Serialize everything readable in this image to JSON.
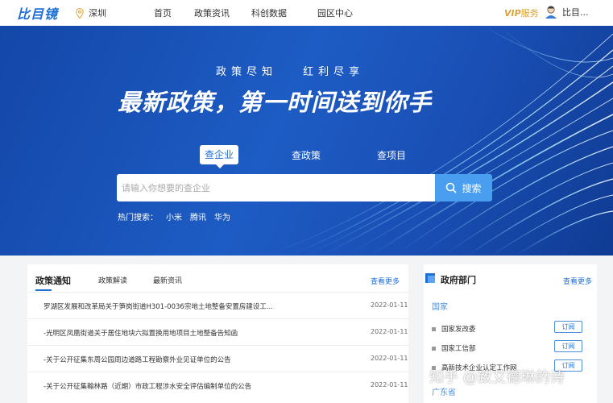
{
  "header": {
    "logo": "比目镜",
    "location": "深圳",
    "nav": [
      "首页",
      "政策资讯",
      "科创数据",
      "园区中心"
    ],
    "vip_label": "VIP",
    "vip_suffix": "服务",
    "user_name": "比目..."
  },
  "hero": {
    "slogan_left": "政策尽知",
    "slogan_right": "红利尽享",
    "headline": "最新政策，第一时间送到你手",
    "tabs": [
      "查企业",
      "查政策",
      "查项目"
    ],
    "active_tab": 0,
    "search_placeholder": "请输入你想要的查企业",
    "search_button": "搜索",
    "hot_label": "热门搜索：",
    "hot_keywords": [
      "小米",
      "腾讯",
      "华为"
    ]
  },
  "policy_panel": {
    "tabs": [
      "政策通知",
      "政策解读",
      "最新资讯"
    ],
    "active_tab": 0,
    "more": "查看更多",
    "items": [
      {
        "title": "罗湖区发展和改革局关于笋岗街道H301-0036宗地土地整备安置房建设工...",
        "date": "2022-01-11"
      },
      {
        "title": "-光明区凤凰街道关于居住地块六拟置换用地项目土地整备告知函",
        "date": "2022-01-11"
      },
      {
        "title": "-关于公开征集东周公园周边道路工程勘察外业见证单位的公告",
        "date": "2022-01-11"
      },
      {
        "title": "-关于公开征集翰林路（近期）市政工程涉水安全评估编制单位的公告",
        "date": "2022-01-11"
      }
    ]
  },
  "gov_panel": {
    "title": "政府部门",
    "more": "查看更多",
    "category": "国家",
    "departments": [
      {
        "name": "国家发改委",
        "action": "订阅"
      },
      {
        "name": "国家工信部",
        "action": "订阅"
      },
      {
        "name": "高新技术企业认定工作网",
        "action": "订阅"
      }
    ],
    "category2": "广东省"
  },
  "watermark": "知乎 @致艾德琳的诗",
  "colors": {
    "brand": "#1f6fd6",
    "hero_bg": "#1d5cc4",
    "search_button": "#4a9ef0",
    "vip": "#d9a33b"
  }
}
